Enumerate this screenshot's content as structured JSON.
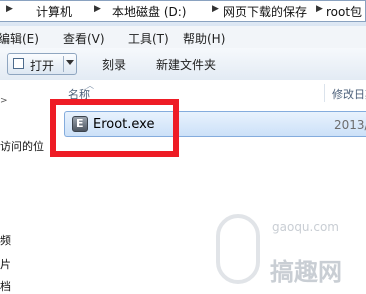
{
  "breadcrumb": [
    "计算机",
    "本地磁盘 (D:)",
    "网页下载的保存",
    "root包"
  ],
  "menu": [
    "编辑(E)",
    "查看(V)",
    "工具(T)",
    "帮助(H)"
  ],
  "toolbar": {
    "open": "打开",
    "burn": "刻录",
    "new_folder": "新建文件夹"
  },
  "nav_items": [
    "访问的位",
    "频",
    "片",
    "档"
  ],
  "columns": {
    "name": "名称",
    "modified": "修改日期"
  },
  "file": {
    "name": "Eroot.exe",
    "date": "2013/"
  },
  "watermark": {
    "url": "gaoqu.com",
    "brand": "搞趣网"
  },
  "colors": {
    "highlight": "#ee1c25",
    "selection": "#cce1f8"
  }
}
